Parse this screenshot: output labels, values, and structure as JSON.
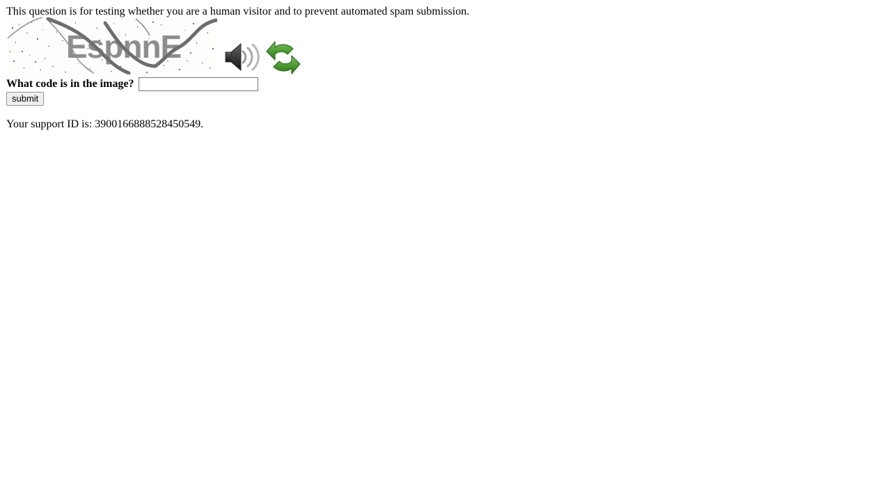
{
  "page": {
    "intro_text": "This question is for testing whether you are a human visitor and to prevent automated spam submission.",
    "support_text": "Your support ID is: 3900166888528450549.",
    "support_id": "3900166888528450549",
    "background_color": "#ffffff",
    "text_color": "#000000"
  },
  "captcha": {
    "image_alt": "captcha-image",
    "code_text": "EspnnE",
    "text_color": "#8d8d8d",
    "background_color": "#fdfdfc",
    "noise_color": "#6f6f6f",
    "audio_icon": "speaker-icon",
    "refresh_icon": "refresh-icon",
    "refresh_icon_color": "#4a9b35"
  },
  "form": {
    "label": "What code is in the image?",
    "input_value": "",
    "input_placeholder": "",
    "submit_label": "submit"
  }
}
